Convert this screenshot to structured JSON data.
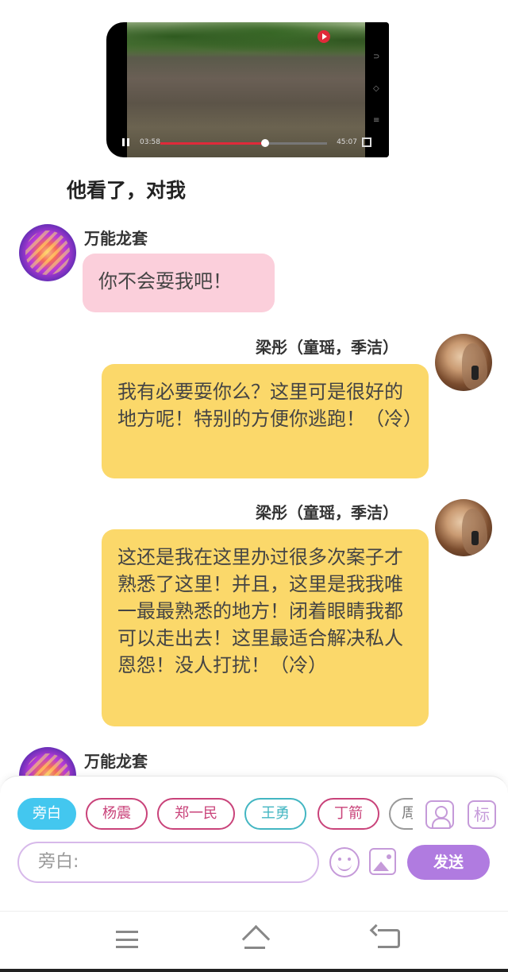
{
  "video": {
    "time_elapsed": "03:58",
    "time_total": "45:07",
    "progress": 0.63,
    "side_icons": [
      "⊃",
      "◇",
      "≡"
    ]
  },
  "narration": "他看了，对我",
  "messages": [
    {
      "sender": "万能龙套",
      "side": "left",
      "text": "你不会耍我吧！"
    },
    {
      "sender": "梁彤（童瑶，季洁）",
      "side": "right",
      "text": "我有必要耍你么？这里可是很好的地方呢！特别的方便你逃跑！（冷）"
    },
    {
      "sender": "梁彤（童瑶，季洁）",
      "side": "right",
      "text": "这还是我在这里办过很多次案子才熟悉了这里！并且，这里是我我唯一最最熟悉的地方！闭着眼睛我都可以走出去！这里最适合解决私人恩怨！没人打扰！（冷）"
    },
    {
      "sender": "万能龙套",
      "side": "left",
      "text": ""
    }
  ],
  "roles": [
    "旁白",
    "杨震",
    "郑一民",
    "王勇",
    "丁箭",
    "周"
  ],
  "tag_button": "标",
  "input": {
    "placeholder": "旁白:"
  },
  "send_label": "发送",
  "colors": {
    "pink_bubble": "#fbcfdb",
    "yellow_bubble": "#fbd86a",
    "active_chip": "#43c7ef",
    "send": "#b07be0"
  }
}
